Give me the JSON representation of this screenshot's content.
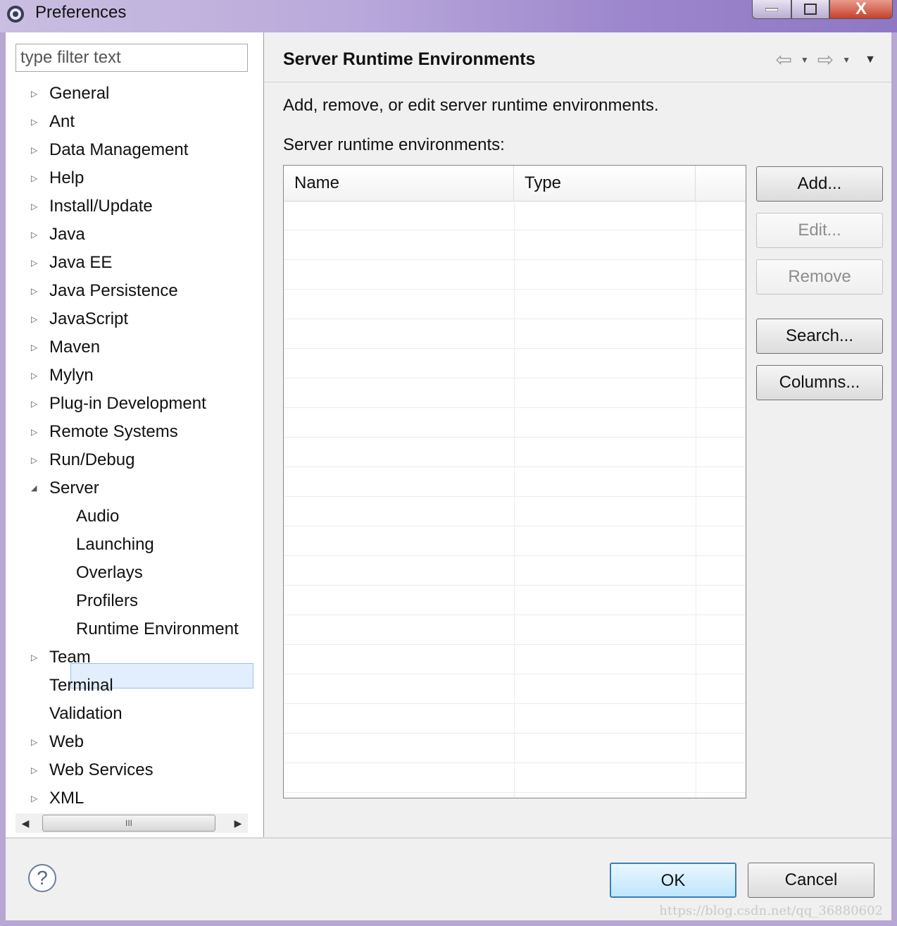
{
  "window": {
    "title": "Preferences",
    "close_glyph": "X"
  },
  "sidebar": {
    "filter_placeholder": "type filter text",
    "items": [
      {
        "label": "General",
        "expander": "▷"
      },
      {
        "label": "Ant",
        "expander": "▷"
      },
      {
        "label": "Data Management",
        "expander": "▷"
      },
      {
        "label": "Help",
        "expander": "▷"
      },
      {
        "label": "Install/Update",
        "expander": "▷"
      },
      {
        "label": "Java",
        "expander": "▷"
      },
      {
        "label": "Java EE",
        "expander": "▷"
      },
      {
        "label": "Java Persistence",
        "expander": "▷"
      },
      {
        "label": "JavaScript",
        "expander": "▷"
      },
      {
        "label": "Maven",
        "expander": "▷"
      },
      {
        "label": "Mylyn",
        "expander": "▷"
      },
      {
        "label": "Plug-in Development",
        "expander": "▷"
      },
      {
        "label": "Remote Systems",
        "expander": "▷"
      },
      {
        "label": "Run/Debug",
        "expander": "▷"
      },
      {
        "label": "Server",
        "expander": "◢"
      },
      {
        "label": "Audio",
        "expander": ""
      },
      {
        "label": "Launching",
        "expander": ""
      },
      {
        "label": "Overlays",
        "expander": ""
      },
      {
        "label": "Profilers",
        "expander": ""
      },
      {
        "label": "Runtime Environment",
        "expander": ""
      },
      {
        "label": "Team",
        "expander": "▷"
      },
      {
        "label": "Terminal",
        "expander": ""
      },
      {
        "label": "Validation",
        "expander": ""
      },
      {
        "label": "Web",
        "expander": "▷"
      },
      {
        "label": "Web Services",
        "expander": "▷"
      },
      {
        "label": "XML",
        "expander": "▷"
      }
    ],
    "scroll": {
      "left": "◀",
      "right": "▶",
      "grip": "III"
    }
  },
  "main": {
    "title": "Server Runtime Environments",
    "nav": {
      "back": "⇦",
      "forward": "⇨",
      "drop": "▼",
      "menu": "▼"
    },
    "description": "Add, remove, or edit server runtime environments.",
    "table_label": "Server runtime environments:",
    "columns": [
      "Name",
      "Type"
    ],
    "buttons": {
      "add": "Add...",
      "edit": "Edit...",
      "remove": "Remove",
      "search": "Search...",
      "columns": "Columns..."
    }
  },
  "footer": {
    "help": "?",
    "ok": "OK",
    "cancel": "Cancel",
    "watermark": "https://blog.csdn.net/qq_36880602"
  },
  "colors": {
    "selection": "#e2eefb",
    "titlebar": "#9d86cc"
  }
}
